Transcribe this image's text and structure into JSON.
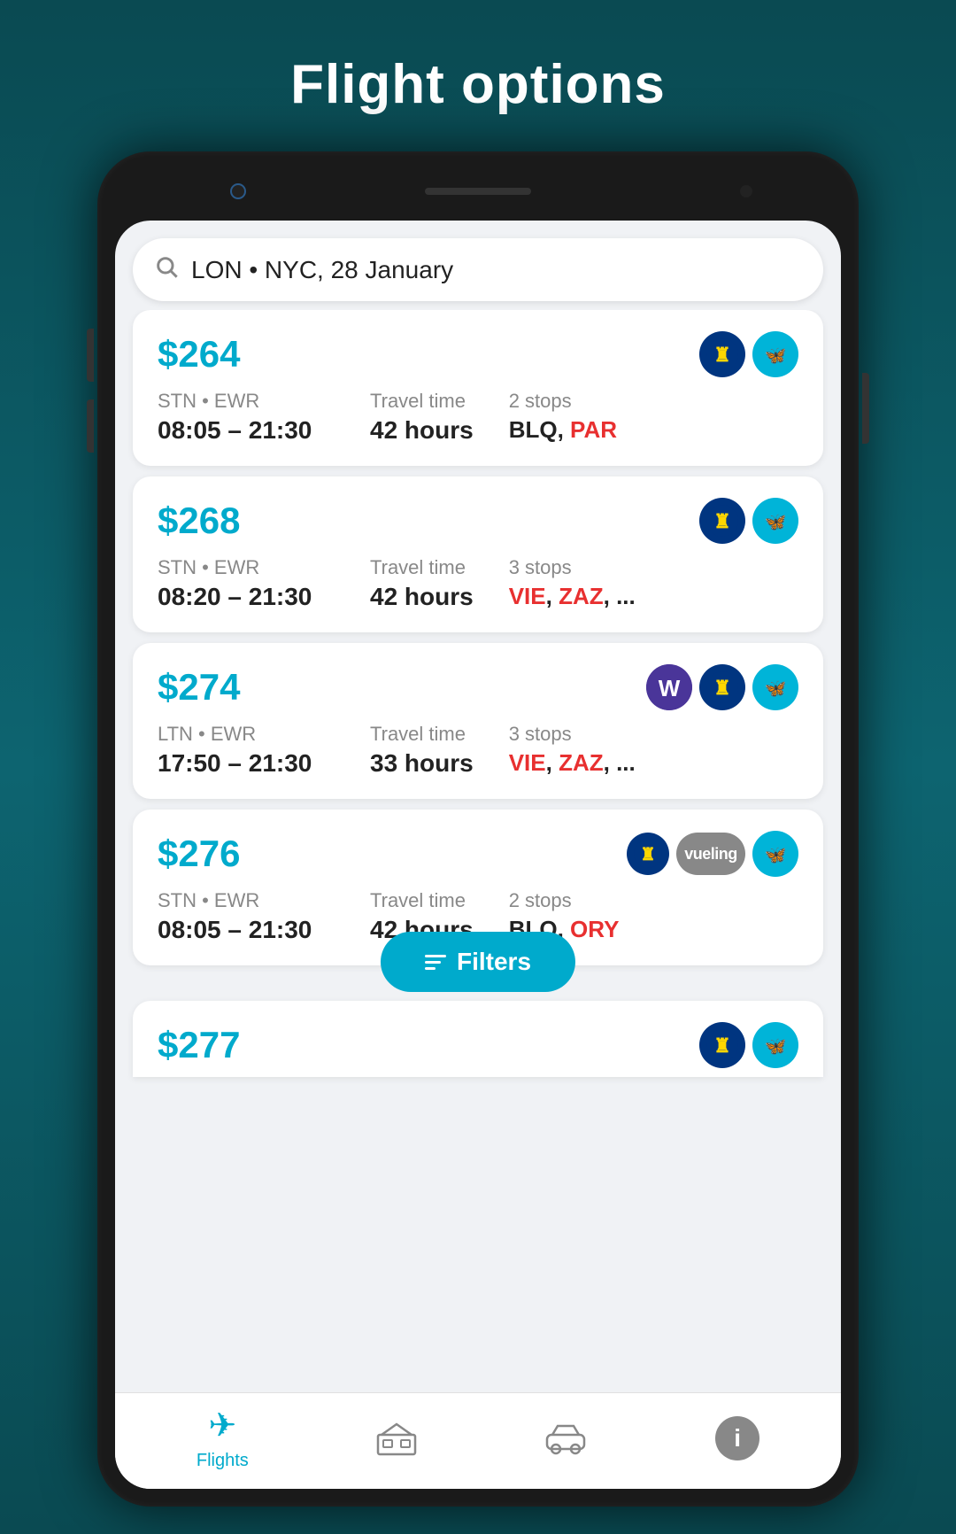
{
  "page": {
    "title": "Flight options",
    "search": {
      "text": "LON • NYC, 28 January"
    },
    "flights": [
      {
        "id": "flight-1",
        "price": "$264",
        "route_airports": "STN • EWR",
        "route_times": "08:05 – 21:30",
        "travel_label": "Travel time",
        "travel_value": "42 hours",
        "stops_label": "2 stops",
        "stops_airports": "BLQ, PAR",
        "stops_highlight": [
          "PAR"
        ],
        "airlines": [
          "ryanair",
          "transavia"
        ]
      },
      {
        "id": "flight-2",
        "price": "$268",
        "route_airports": "STN • EWR",
        "route_times": "08:20 – 21:30",
        "travel_label": "Travel time",
        "travel_value": "42 hours",
        "stops_label": "3 stops",
        "stops_airports": "VIE, ZAZ, ...",
        "stops_highlight": [
          "VIE",
          "ZAZ"
        ],
        "airlines": [
          "ryanair",
          "transavia"
        ]
      },
      {
        "id": "flight-3",
        "price": "$274",
        "route_airports": "LTN • EWR",
        "route_times": "17:50 – 21:30",
        "travel_label": "Travel time",
        "travel_value": "33 hours",
        "stops_label": "3 stops",
        "stops_airports": "VIE, ZAZ, ...",
        "stops_highlight": [
          "VIE",
          "ZAZ"
        ],
        "airlines": [
          "wideroe",
          "ryanair",
          "transavia"
        ]
      },
      {
        "id": "flight-4",
        "price": "$276",
        "route_airports": "STN • EWR",
        "route_times": "08:05 – 21:30",
        "travel_label": "Travel time",
        "travel_value": "42 hours",
        "stops_label": "2 stops",
        "stops_airports": "BLQ, ORY",
        "stops_highlight": [
          "ORY"
        ],
        "airlines": [
          "ryanair-small",
          "vueling",
          "transavia"
        ]
      },
      {
        "id": "flight-5",
        "price": "$277",
        "airlines": [
          "ryanair",
          "transavia"
        ],
        "partial": true
      }
    ],
    "filters_button": "Filters",
    "bottom_nav": {
      "items": [
        {
          "id": "flights",
          "label": "Flights",
          "icon": "✈",
          "active": true
        },
        {
          "id": "hotels",
          "label": "",
          "icon": "🛏",
          "active": false
        },
        {
          "id": "cars",
          "label": "",
          "icon": "🚗",
          "active": false
        },
        {
          "id": "info",
          "label": "",
          "icon": "i",
          "active": false
        }
      ]
    }
  }
}
